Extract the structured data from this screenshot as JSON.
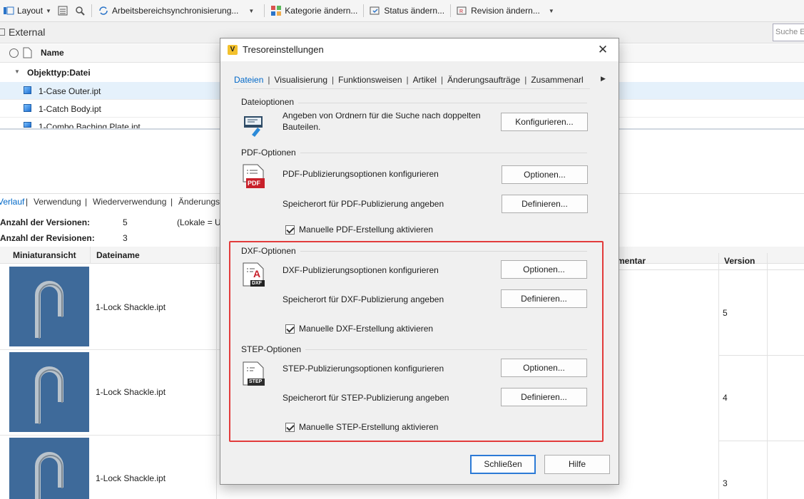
{
  "toolbar": {
    "layout_label": "Layout",
    "sync_label": "Arbeitsbereichsynchronisierung...",
    "category_label": "Kategorie ändern...",
    "status_label": "Status ändern...",
    "revision_label": "Revision ändern..."
  },
  "window": {
    "title": "External",
    "search_placeholder": "Suche E"
  },
  "grid": {
    "name_header": "Name",
    "group_label": "Objekttyp:Datei",
    "rows": [
      "1-Case Outer.ipt",
      "1-Catch Body.ipt",
      "1-Combo Baching Plate.ipt"
    ]
  },
  "details": {
    "tabs": [
      "Verlauf",
      "Verwendung",
      "Wiederverwendung",
      "Änderungs"
    ],
    "versions_label": "Anzahl der Versionen:",
    "versions_value": "5",
    "local_label": "(Lokale = U",
    "revisions_label": "Anzahl der Revisionen:",
    "revisions_value": "3",
    "col_thumbnail": "Miniaturansicht",
    "col_filename": "Dateiname",
    "col_comment": "mentar",
    "col_version": "Version",
    "rows": [
      {
        "filename": "1-Lock Shackle.ipt",
        "version": "5"
      },
      {
        "filename": "1-Lock Shackle.ipt",
        "version": "4"
      },
      {
        "filename": "1-Lock Shackle.ipt",
        "version": "3"
      }
    ]
  },
  "dialog": {
    "app_icon_letter": "V",
    "title": "Tresoreinstellungen",
    "close_glyph": "✕",
    "tabs": [
      "Dateien",
      "Visualisierung",
      "Funktionsweisen",
      "Artikel",
      "Änderungsaufträge",
      "Zusammenarl"
    ],
    "tab_arrow": "▶",
    "file_options": {
      "header": "Dateioptionen",
      "text_line1": "Angeben von Ordnern für die Suche nach doppelten",
      "text_line2": "Bauteilen.",
      "button": "Konfigurieren..."
    },
    "pdf": {
      "header": "PDF-Optionen",
      "badge": "PDF",
      "configure_text": "PDF-Publizierungsoptionen konfigurieren",
      "configure_button": "Optionen...",
      "location_text": "Speicherort für PDF-Publizierung angeben",
      "location_button": "Definieren...",
      "manual_label": "Manuelle PDF-Erstellung aktivieren"
    },
    "dxf": {
      "header": "DXF-Optionen",
      "badge": "DXF",
      "icon_letter": "A",
      "configure_text": "DXF-Publizierungsoptionen konfigurieren",
      "configure_button": "Optionen...",
      "location_text": "Speicherort für DXF-Publizierung angeben",
      "location_button": "Definieren...",
      "manual_label": "Manuelle DXF-Erstellung aktivieren"
    },
    "step": {
      "header": "STEP-Optionen",
      "badge": "STEP",
      "configure_text": "STEP-Publizierungsoptionen konfigurieren",
      "configure_button": "Optionen...",
      "location_text": "Speicherort für STEP-Publizierung angeben",
      "location_button": "Definieren...",
      "manual_label": "Manuelle STEP-Erstellung aktivieren"
    },
    "close_button": "Schließen",
    "help_button": "Hilfe",
    "colors": {
      "highlight": "#e23b3b",
      "active_tab": "#0068c8",
      "pdf_red": "#c8202a"
    }
  }
}
